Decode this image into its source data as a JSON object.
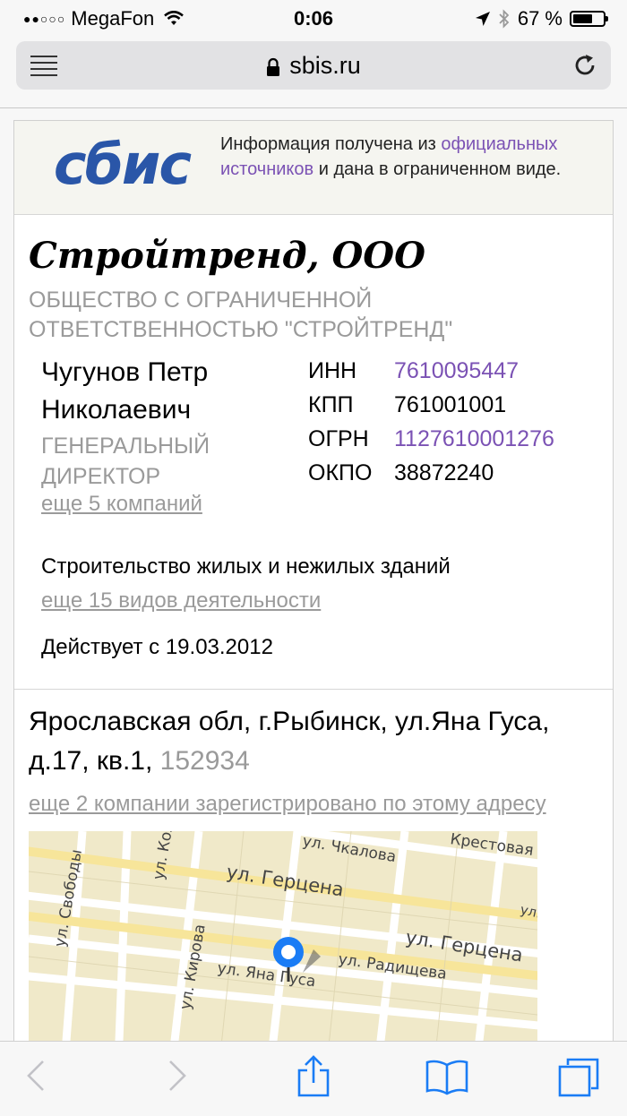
{
  "status_bar": {
    "carrier": "MegaFon",
    "time": "0:06",
    "battery_percent": "67 %",
    "battery_level": 0.67
  },
  "browser": {
    "url": "sbis.ru"
  },
  "banner": {
    "logo_text": "сбис",
    "text_before": "Информация получена из",
    "link_text": "официальных источников",
    "text_after": "и дана в ограниченном виде."
  },
  "company": {
    "short_name": "Стройтренд, ООО",
    "full_name": "ОБЩЕСТВО С ОГРАНИЧЕННОЙ ОТВЕТСТВЕННОСТЬЮ \"СТРОЙТРЕНД\"",
    "director": {
      "name": "Чугунов Петр Николаевич",
      "role": "ГЕНЕРАЛЬНЫЙ ДИРЕКТОР",
      "more_link": "еще 5 компаний"
    },
    "codes": [
      {
        "label": "ИНН",
        "value": "7610095447",
        "link": true
      },
      {
        "label": "КПП",
        "value": "761001001",
        "link": false
      },
      {
        "label": "ОГРН",
        "value": "1127610001276",
        "link": true
      },
      {
        "label": "ОКПО",
        "value": "38872240",
        "link": false
      }
    ],
    "activity": "Строительство жилых и нежилых зданий",
    "activity_more_link": "еще 15 видов деятельности",
    "active_since": "Действует с 19.03.2012"
  },
  "address": {
    "text": "Ярославская обл, г.Рыбинск, ул.Яна Гуса, д.17, кв.1,",
    "zip": "152934",
    "more_link": "еще 2 компании зарегистрировано по этому адресу"
  },
  "map": {
    "streets": [
      "ул. Чкалова",
      "Крестовая",
      "ул. Герцена",
      "ул. Герцена",
      "ул. Радищева",
      "ул. Яна Гуса",
      "ул. Кирова",
      "ул. Свободы",
      "ул. Кол",
      "ул. Чк"
    ]
  },
  "colors": {
    "link_purple": "#7b52b4",
    "grey_text": "#9a9a9a",
    "ios_blue": "#1a7cf5",
    "sbis_blue": "#2a56a8"
  }
}
